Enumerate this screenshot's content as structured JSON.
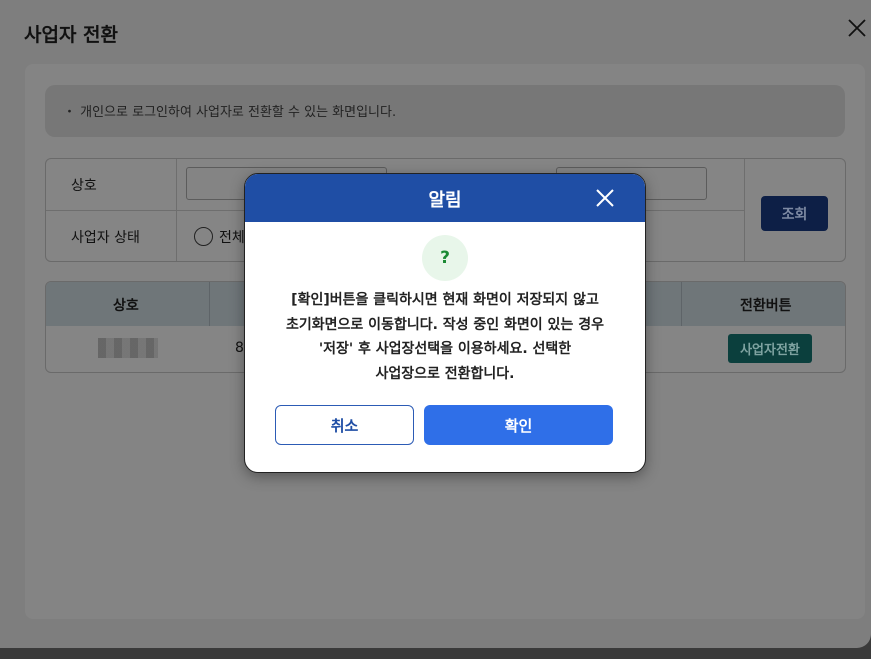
{
  "window": {
    "title": "사업자 전환"
  },
  "notice": {
    "text": "・ 개인으로 로그인하여 사업자로 전환할 수 있는 화면입니다."
  },
  "search": {
    "name_label": "상호",
    "status_label": "사업자 상태",
    "radio_all_label": "전체",
    "search_button": "조회"
  },
  "table": {
    "headers": {
      "name": "상호",
      "switch": "전환버튼"
    },
    "rows": [
      {
        "number_partial": "8",
        "switch_button": "사업자전환"
      }
    ]
  },
  "modal": {
    "title": "알림",
    "icon": "question-icon",
    "icon_glyph": "?",
    "message_lines": [
      "[확인]버튼을 클릭하시면 현재 화면이 저장되지 않고",
      "초기화면으로 이동합니다. 작성 중인 화면이 있는 경우",
      "'저장' 후 사업장선택을 이용하세요. 선택한",
      "사업장으로 전환합니다."
    ],
    "cancel_label": "취소",
    "ok_label": "확인"
  },
  "colors": {
    "modal_header": "#1f4ea5",
    "ok_button": "#2f6fe8",
    "question_icon": "#1b8a34"
  }
}
